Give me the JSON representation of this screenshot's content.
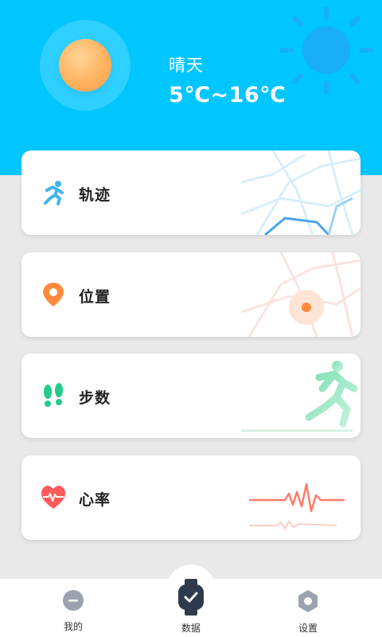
{
  "weather": {
    "condition": "晴天",
    "temperature": "5℃~16℃",
    "icon": "sun-icon"
  },
  "cards": [
    {
      "label": "轨迹",
      "icon": "running-person-icon",
      "icon_color": "#3fb4f0"
    },
    {
      "label": "位置",
      "icon": "location-pin-icon",
      "icon_color": "#ff8a3d"
    },
    {
      "label": "步数",
      "icon": "footprints-icon",
      "icon_color": "#22cc88"
    },
    {
      "label": "心率",
      "icon": "heart-rate-icon",
      "icon_color": "#ff5a5a"
    }
  ],
  "tabbar": {
    "items": [
      {
        "label": "我的",
        "icon": "minus-circle-icon"
      },
      {
        "label": "数据",
        "icon": "watch-check-icon",
        "active": true
      },
      {
        "label": "设置",
        "icon": "hexagon-settings-icon"
      }
    ]
  },
  "colors": {
    "header": "#00c6ff",
    "background": "#e9e9e9",
    "tab_active": "#2f3b4c",
    "tab_inactive": "#9aa3ad"
  }
}
